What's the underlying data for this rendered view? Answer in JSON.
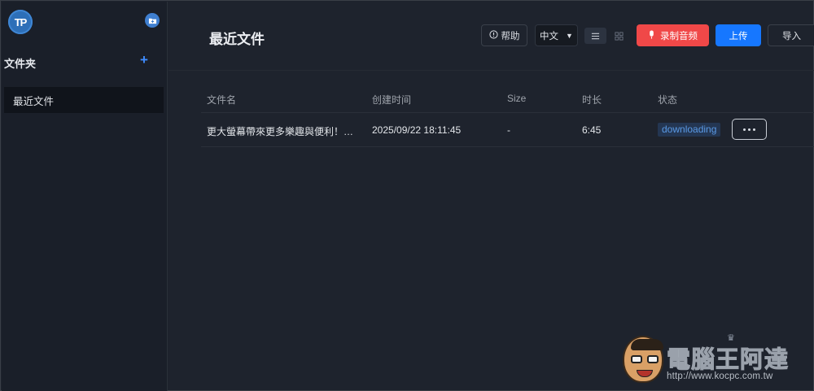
{
  "sidebar": {
    "logo_text": "TP",
    "folder_icon": "folder-plus-icon",
    "folders_title": "文件夹",
    "add_label": "+",
    "items": [
      {
        "label": "最近文件",
        "active": true
      }
    ]
  },
  "header": {
    "title": "最近文件",
    "help_label": "帮助",
    "help_icon": "info-circle-icon",
    "language_value": "中文",
    "language_caret": "▼",
    "view_modes": [
      "list-view-icon",
      "grid-view-icon"
    ],
    "record_label": "录制音频",
    "record_icon": "microphone-icon",
    "upload_label": "上传",
    "import_label": "导入"
  },
  "table": {
    "columns": [
      "文件名",
      "创建时间",
      "Size",
      "时长",
      "状态"
    ],
    "rows": [
      {
        "name": "更大螢幕帶來更多樂趣與便利！War...",
        "created": "2025/09/22 18:11:45",
        "size": "-",
        "duration": "6:45",
        "status": "downloading"
      }
    ]
  },
  "watermark": {
    "title": "電腦王阿達",
    "url": "http://www.kocpc.com.tw"
  },
  "colors": {
    "accent": "#1677ff",
    "record": "#f04848",
    "status_text": "#5a9ae6",
    "background": "#1e232d",
    "sidebar": "#1a1f29"
  }
}
